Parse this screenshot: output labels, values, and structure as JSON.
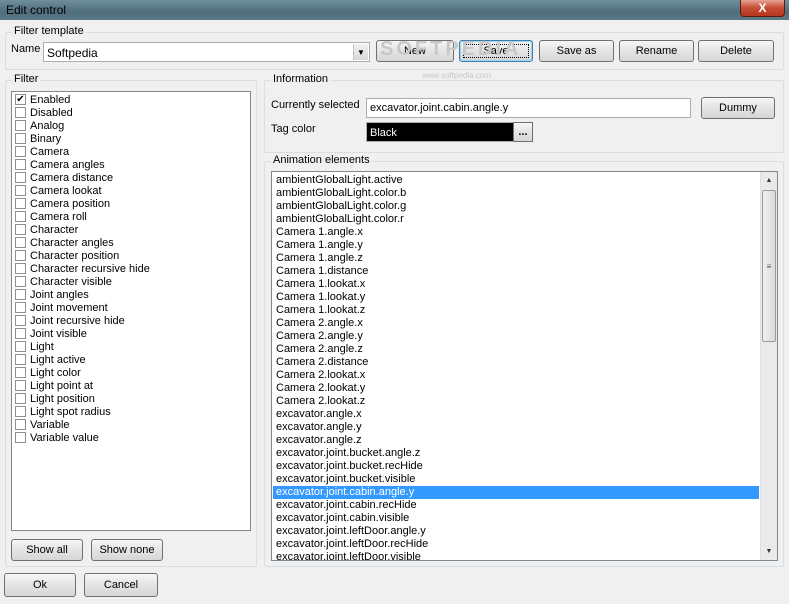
{
  "window": {
    "title": "Edit control",
    "close_symbol": "X"
  },
  "filter_template": {
    "group_label": "Filter template",
    "name_label": "Name",
    "name_value": "Softpedia",
    "buttons": {
      "new": "New",
      "save": "Save",
      "save_as": "Save as",
      "rename": "Rename",
      "delete": "Delete"
    }
  },
  "filter": {
    "group_label": "Filter",
    "items": [
      {
        "label": "Enabled",
        "checked": true
      },
      {
        "label": "Disabled",
        "checked": false
      },
      {
        "label": "Analog",
        "checked": false
      },
      {
        "label": "Binary",
        "checked": false
      },
      {
        "label": "Camera",
        "checked": false
      },
      {
        "label": "Camera angles",
        "checked": false
      },
      {
        "label": "Camera distance",
        "checked": false
      },
      {
        "label": "Camera lookat",
        "checked": false
      },
      {
        "label": "Camera position",
        "checked": false
      },
      {
        "label": "Camera roll",
        "checked": false
      },
      {
        "label": "Character",
        "checked": false
      },
      {
        "label": "Character angles",
        "checked": false
      },
      {
        "label": "Character position",
        "checked": false
      },
      {
        "label": "Character recursive hide",
        "checked": false
      },
      {
        "label": "Character visible",
        "checked": false
      },
      {
        "label": "Joint angles",
        "checked": false
      },
      {
        "label": "Joint movement",
        "checked": false
      },
      {
        "label": "Joint recursive hide",
        "checked": false
      },
      {
        "label": "Joint visible",
        "checked": false
      },
      {
        "label": "Light",
        "checked": false
      },
      {
        "label": "Light active",
        "checked": false
      },
      {
        "label": "Light color",
        "checked": false
      },
      {
        "label": "Light point at",
        "checked": false
      },
      {
        "label": "Light position",
        "checked": false
      },
      {
        "label": "Light spot radius",
        "checked": false
      },
      {
        "label": "Variable",
        "checked": false
      },
      {
        "label": "Variable value",
        "checked": false
      }
    ],
    "show_all": "Show all",
    "show_none": "Show none"
  },
  "information": {
    "group_label": "Information",
    "currently_selected_label": "Currently selected",
    "currently_selected_value": "excavator.joint.cabin.angle.y",
    "dummy_button": "Dummy",
    "tag_color_label": "Tag color",
    "tag_color_value": "Black",
    "tag_color_hex": "#000000",
    "ellipsis": "..."
  },
  "animation": {
    "group_label": "Animation elements",
    "selected_index": 24,
    "items": [
      "ambientGlobalLight.active",
      "ambientGlobalLight.color.b",
      "ambientGlobalLight.color.g",
      "ambientGlobalLight.color.r",
      "Camera 1.angle.x",
      "Camera 1.angle.y",
      "Camera 1.angle.z",
      "Camera 1.distance",
      "Camera 1.lookat.x",
      "Camera 1.lookat.y",
      "Camera 1.lookat.z",
      "Camera 2.angle.x",
      "Camera 2.angle.y",
      "Camera 2.angle.z",
      "Camera 2.distance",
      "Camera 2.lookat.x",
      "Camera 2.lookat.y",
      "Camera 2.lookat.z",
      "excavator.angle.x",
      "excavator.angle.y",
      "excavator.angle.z",
      "excavator.joint.bucket.angle.z",
      "excavator.joint.bucket.recHide",
      "excavator.joint.bucket.visible",
      "excavator.joint.cabin.angle.y",
      "excavator.joint.cabin.recHide",
      "excavator.joint.cabin.visible",
      "excavator.joint.leftDoor.angle.y",
      "excavator.joint.leftDoor.recHide",
      "excavator.joint.leftDoor.visible"
    ]
  },
  "footer": {
    "ok": "Ok",
    "cancel": "Cancel"
  },
  "watermark": {
    "text": "SOFTPEDIA",
    "url": "www.softpedia.com"
  },
  "colors": {
    "selection": "#3399ff",
    "window_bg": "#f0f0f0"
  }
}
